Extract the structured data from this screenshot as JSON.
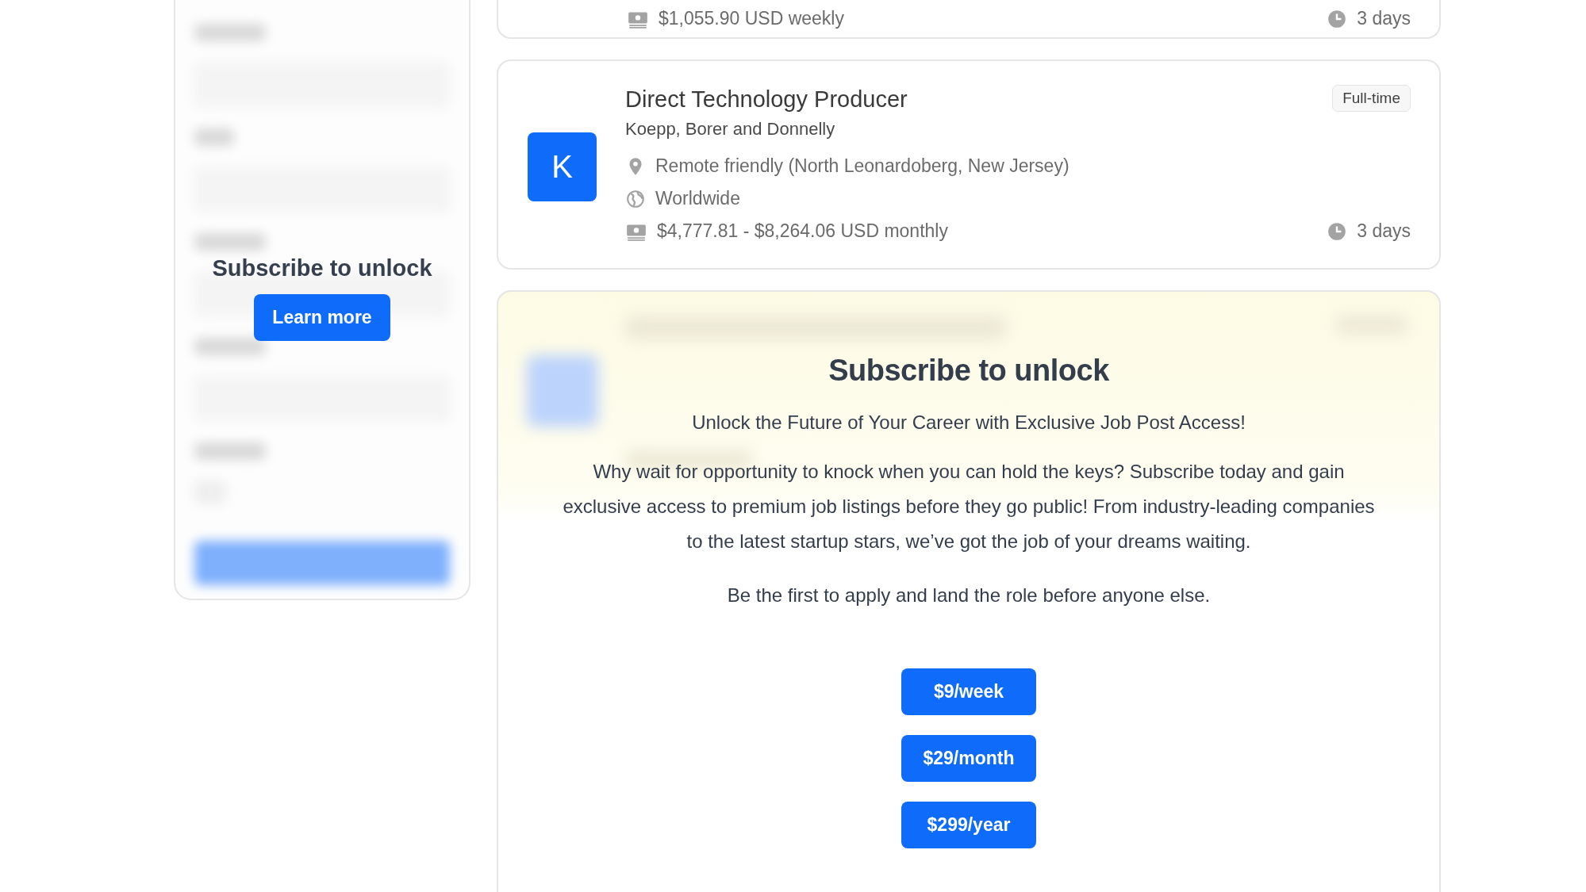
{
  "sidebar": {
    "title": "Subscribe to unlock",
    "button": "Learn more"
  },
  "previous_job": {
    "salary": "$1,055.90 USD weekly",
    "posted": "3 days"
  },
  "job": {
    "logo_letter": "K",
    "title": "Direct Technology Producer",
    "company": "Koepp, Borer and Donnelly",
    "type": "Full-time",
    "location": "Remote friendly (North Leonardoberg, New Jersey)",
    "region": "Worldwide",
    "salary": "$4,777.81 - $8,264.06 USD monthly",
    "posted": "3 days"
  },
  "paywall": {
    "title": "Subscribe to unlock",
    "subtitle": "Unlock the Future of Your Career with Exclusive Job Post Access!",
    "paragraphs": [
      "Why wait for opportunity to knock when you can hold the keys? Subscribe today and gain exclusive access to premium job listings before they go public! From industry-leading companies to the latest startup stars, we’ve got the job of your dreams waiting.",
      "Be the first to apply and land the role before anyone else."
    ],
    "plans": [
      "$9/week",
      "$29/month",
      "$299/year"
    ]
  }
}
